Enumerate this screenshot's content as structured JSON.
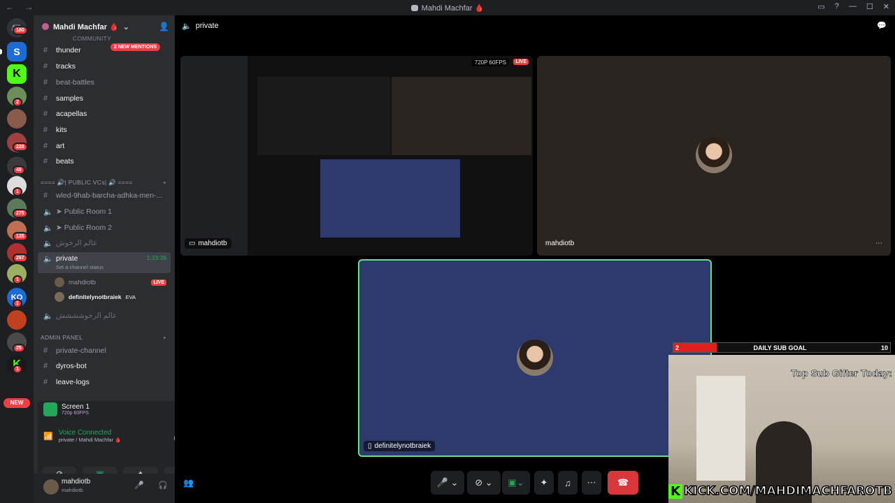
{
  "window": {
    "title": "Mahdi Machfar 🩸"
  },
  "servers": {
    "home_badge": "180",
    "badges": [
      "2",
      "228",
      "48",
      "1",
      "275",
      "135",
      "267",
      "1",
      "1",
      "25",
      "1"
    ],
    "new_label": "NEW"
  },
  "sidebar": {
    "server_name": "Mahdi Machfar 🩸",
    "mentions_pill": "2 NEW MENTIONS",
    "community_cat": "COMMUNITY",
    "text_channels": [
      {
        "label": "thunder",
        "icon": "hash-thread-icon"
      },
      {
        "label": "tracks",
        "icon": "hash-thread-icon"
      },
      {
        "label": "beat-battles",
        "icon": "hash-thread-icon"
      },
      {
        "label": "samples",
        "icon": "hash-thread-icon"
      },
      {
        "label": "acapellas",
        "icon": "hash-thread-icon"
      },
      {
        "label": "kits",
        "icon": "hash-thread-icon"
      },
      {
        "label": "art",
        "icon": "hash-thread-icon"
      },
      {
        "label": "beats",
        "icon": "hash-thread-icon"
      }
    ],
    "public_cat": "==== 🔊| PUBLIC VCs| 🔊 ====",
    "public_channels": [
      {
        "label": "wled-9hab-barcha-adhka-men-..."
      },
      {
        "label": "➤ Public Room 1"
      },
      {
        "label": "➤ Public Room 2"
      },
      {
        "label": "عالم الرخوش"
      }
    ],
    "private": {
      "label": "private",
      "timer": "1:33:39",
      "status": "Set a channel status",
      "users": [
        {
          "name": "mahdiotb",
          "badge": "LIVE"
        },
        {
          "name": "definitelynotbraiek",
          "tag": "EVA"
        }
      ]
    },
    "other_voice": "عالم الرخوشششش",
    "admin_cat": "ADMIN PANEL",
    "admin_channels": [
      {
        "label": "private-channel"
      },
      {
        "label": "dyros-bot"
      },
      {
        "label": "leave-logs"
      }
    ]
  },
  "screen_panel": {
    "title": "Screen 1",
    "quality": "720p 60FPS",
    "voice_status": "Voice Connected",
    "voice_location": "private / Mahdi Machfar 🩸"
  },
  "userbar": {
    "name": "mahdiotb",
    "sub": "mahdiotb"
  },
  "channel": {
    "name": "private"
  },
  "stream": {
    "quality_badge": "720P 60FPS",
    "live": "LIVE",
    "streamer_name": "mahdiotb",
    "camera_name": "mahdiotb",
    "main_name": "definitelynotbraiek"
  },
  "overlay": {
    "goal_current": "2",
    "goal_label": "DAILY SUB GOAL",
    "goal_target": "10",
    "goal_fraction": 0.2,
    "top_gifter": "Top Sub Gifter Today:",
    "kick_url": "KICK.COM/MAHDIMACHFAROTB"
  },
  "colors": {
    "accent": "#5865f2",
    "live": "#f23f43",
    "connected": "#23a55a",
    "tile_blue": "#2e3a6e",
    "kick": "#53fc18"
  }
}
